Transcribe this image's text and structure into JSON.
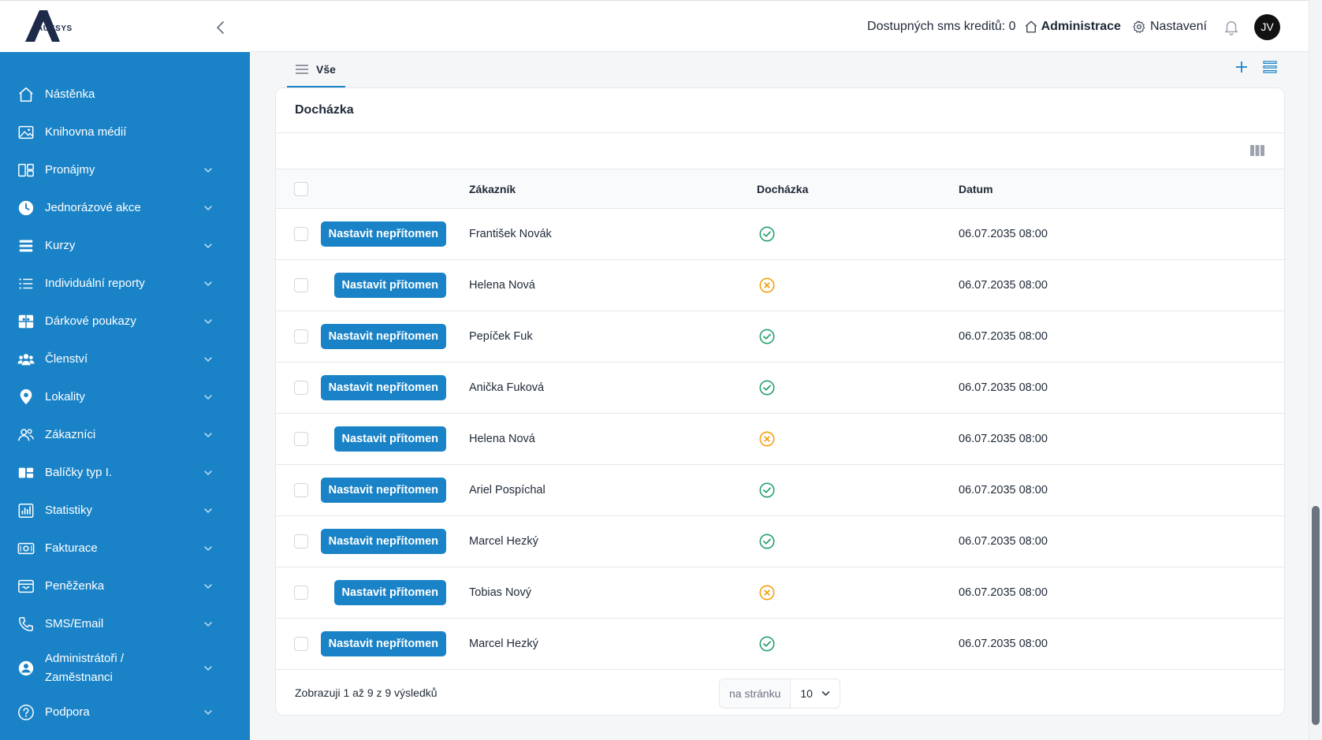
{
  "app": {
    "logo_text": "AUKSYS"
  },
  "header": {
    "credits": "Dostupných sms kreditů: 0",
    "admin_label": "Administrace",
    "settings_label": "Nastavení",
    "avatar_initials": "JV"
  },
  "sidebar": {
    "items": [
      {
        "label": "Nástěnka",
        "icon": "home-icon",
        "has_chevron": false
      },
      {
        "label": "Knihovna médií",
        "icon": "image-icon",
        "has_chevron": false
      },
      {
        "label": "Pronájmy",
        "icon": "layout-icon",
        "has_chevron": true
      },
      {
        "label": "Jednorázové akce",
        "icon": "clock-icon",
        "has_chevron": true
      },
      {
        "label": "Kurzy",
        "icon": "stack-icon",
        "has_chevron": true
      },
      {
        "label": "Individuální reporty",
        "icon": "list-icon",
        "has_chevron": true
      },
      {
        "label": "Dárkové poukazy",
        "icon": "gift-icon",
        "has_chevron": true
      },
      {
        "label": "Členství",
        "icon": "users-icon",
        "has_chevron": true
      },
      {
        "label": "Lokality",
        "icon": "map-pin-icon",
        "has_chevron": true
      },
      {
        "label": "Zákazníci",
        "icon": "customers-icon",
        "has_chevron": true
      },
      {
        "label": "Balíčky typ I.",
        "icon": "package-icon",
        "has_chevron": true
      },
      {
        "label": "Statistiky",
        "icon": "chart-icon",
        "has_chevron": true
      },
      {
        "label": "Fakturace",
        "icon": "invoice-icon",
        "has_chevron": true
      },
      {
        "label": "Peněženka",
        "icon": "wallet-icon",
        "has_chevron": true
      },
      {
        "label": "SMS/Email",
        "icon": "phone-icon",
        "has_chevron": true
      },
      {
        "label": "Administrátoři / Zaměstnanci",
        "icon": "user-circle-icon",
        "has_chevron": true
      },
      {
        "label": "Podpora",
        "icon": "help-icon",
        "has_chevron": true
      }
    ]
  },
  "tabs": [
    {
      "label": "Vše",
      "active": true
    }
  ],
  "card": {
    "title": "Docházka",
    "columns": {
      "customer": "Zákazník",
      "attendance": "Docházka",
      "date": "Datum"
    },
    "rows": [
      {
        "action": "Nastavit nepřítomen",
        "customer": "František Novák",
        "present": true,
        "date": "06.07.2035 08:00"
      },
      {
        "action": "Nastavit přítomen",
        "customer": "Helena Nová",
        "present": false,
        "date": "06.07.2035 08:00"
      },
      {
        "action": "Nastavit nepřítomen",
        "customer": "Pepíček Fuk",
        "present": true,
        "date": "06.07.2035 08:00"
      },
      {
        "action": "Nastavit nepřítomen",
        "customer": "Anička Fuková",
        "present": true,
        "date": "06.07.2035 08:00"
      },
      {
        "action": "Nastavit přítomen",
        "customer": "Helena Nová",
        "present": false,
        "date": "06.07.2035 08:00"
      },
      {
        "action": "Nastavit nepřítomen",
        "customer": "Ariel Pospíchal",
        "present": true,
        "date": "06.07.2035 08:00"
      },
      {
        "action": "Nastavit nepřítomen",
        "customer": "Marcel Hezký",
        "present": true,
        "date": "06.07.2035 08:00"
      },
      {
        "action": "Nastavit přítomen",
        "customer": "Tobias Nový",
        "present": false,
        "date": "06.07.2035 08:00"
      },
      {
        "action": "Nastavit nepřítomen",
        "customer": "Marcel Hezký",
        "present": true,
        "date": "06.07.2035 08:00"
      }
    ],
    "footer": {
      "summary": "Zobrazuji 1 až 9 z 9 výsledků",
      "per_page_label": "na stránku",
      "per_page_value": "10"
    }
  },
  "colors": {
    "primary": "#1a83c7",
    "present": "#22a06b",
    "absent": "#f59e0b"
  }
}
